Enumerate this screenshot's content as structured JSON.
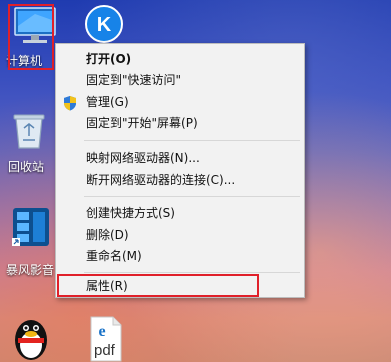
{
  "desktop": {
    "icons": [
      {
        "label": "计算机",
        "icon": "computer-icon"
      },
      {
        "label": "",
        "icon": "kugou-app-icon"
      },
      {
        "label": "回收站",
        "icon": "recycle-bin-icon"
      },
      {
        "label": "暴风影音",
        "icon": "media-player-icon"
      },
      {
        "label": "",
        "icon": "qq-penguin-icon"
      },
      {
        "label": "pdf",
        "icon": "pdf-file-icon"
      }
    ]
  },
  "context_menu": {
    "items": [
      {
        "label": "打开(O)",
        "bold": true
      },
      {
        "label": "固定到\"快速访问\""
      },
      {
        "label": "管理(G)",
        "icon": "uac-shield-icon"
      },
      {
        "label": "固定到\"开始\"屏幕(P)"
      },
      {
        "label": "映射网络驱动器(N)..."
      },
      {
        "label": "断开网络驱动器的连接(C)..."
      },
      {
        "label": "创建快捷方式(S)"
      },
      {
        "label": "删除(D)"
      },
      {
        "label": "重命名(M)"
      },
      {
        "label": "属性(R)",
        "highlighted": true
      }
    ]
  },
  "colors": {
    "highlight": "#e0202a",
    "menu_bg": "#f2f2f2"
  }
}
